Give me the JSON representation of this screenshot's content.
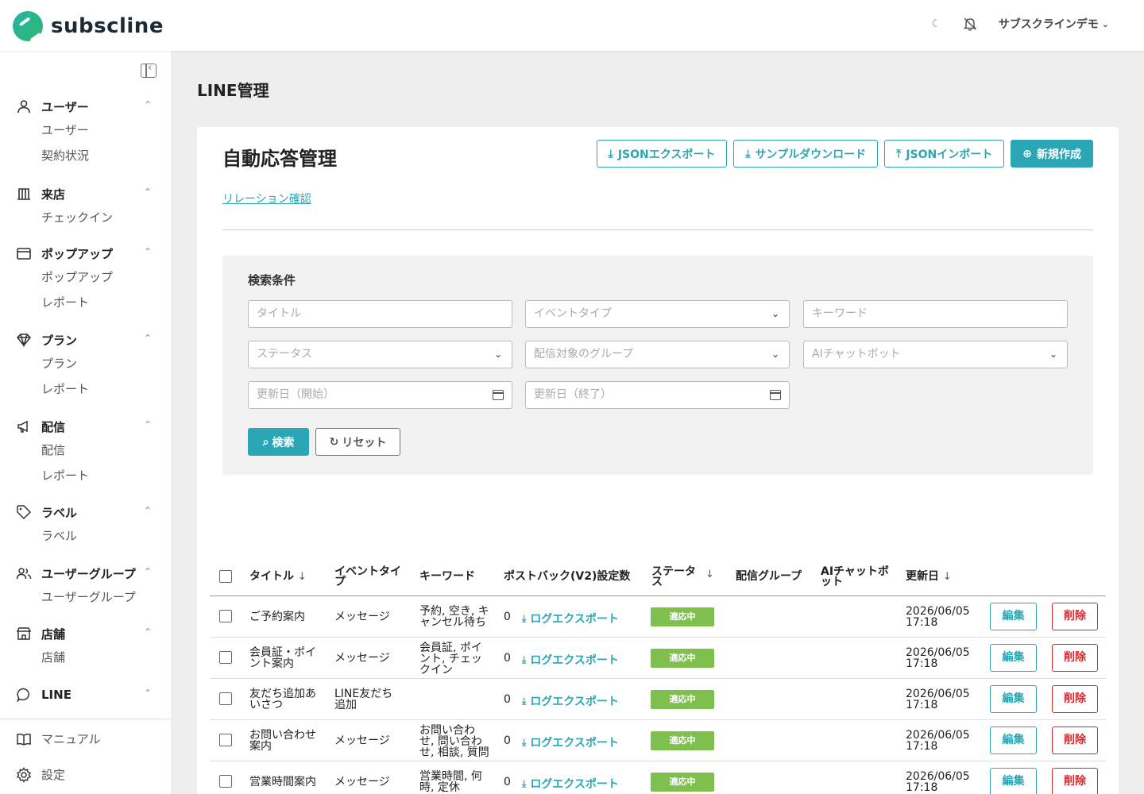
{
  "header": {
    "brand": "subscline",
    "user_menu": "サブスクラインデモ"
  },
  "sidebar": {
    "groups": [
      {
        "label": "ユーザー",
        "items": [
          "ユーザー",
          "契約状況"
        ]
      },
      {
        "label": "来店",
        "items": [
          "チェックイン"
        ]
      },
      {
        "label": "ポップアップ",
        "items": [
          "ポップアップ",
          "レポート"
        ]
      },
      {
        "label": "プラン",
        "items": [
          "プラン",
          "レポート"
        ]
      },
      {
        "label": "配信",
        "items": [
          "配信",
          "レポート"
        ]
      },
      {
        "label": "ラベル",
        "items": [
          "ラベル"
        ]
      },
      {
        "label": "ユーザーグループ",
        "items": [
          "ユーザーグループ"
        ]
      },
      {
        "label": "店舗",
        "items": [
          "店舗"
        ]
      },
      {
        "label": "LINE",
        "items": []
      }
    ],
    "bottom": {
      "manual": "マニュアル",
      "settings": "設定"
    }
  },
  "page": {
    "title": "LINE管理"
  },
  "card": {
    "title": "自動応答管理",
    "buttons": {
      "json_export": "JSONエクスポート",
      "sample_download": "サンプルダウンロード",
      "json_import": "JSONインポート",
      "create": "新規作成"
    },
    "relation_link": "リレーション確認"
  },
  "search": {
    "title": "検索条件",
    "placeholders": {
      "title": "タイトル",
      "event_type": "イベントタイプ",
      "keyword": "キーワード",
      "status": "ステータス",
      "group": "配信対象のグループ",
      "chatbot": "AIチャットボット",
      "date_start": "更新日（開始）",
      "date_end": "更新日（終了）"
    },
    "search_btn": "検索",
    "reset_btn": "リセット"
  },
  "table": {
    "columns": {
      "title": "タイトル",
      "event_type": "イベントタイ\nプ",
      "keyword": "キーワード",
      "postback": "ポストバック(V2)設定数",
      "status": "ステータ\nス",
      "group": "配信グループ",
      "chatbot": "AIチャットボ\nット",
      "updated": "更新日"
    },
    "log_export_label": "ログエクスポート",
    "edit_label": "編集",
    "delete_label": "削除",
    "rows": [
      {
        "title": "ご予約案内",
        "event_type": "メッセージ",
        "keyword": "予約, 空き, キ\nャンセル待ち",
        "postback": "0",
        "status": "適応中",
        "updated": "2026/06/05\n17:18"
      },
      {
        "title": "会員証・ポイ\nント案内",
        "event_type": "メッセージ",
        "keyword": "会員証, ポイ\nント, チェッ\nクイン",
        "postback": "0",
        "status": "適応中",
        "updated": "2026/06/05\n17:18"
      },
      {
        "title": "友だち追加あ\nいさつ",
        "event_type": "LINE友だち\n追加",
        "keyword": "",
        "postback": "0",
        "status": "適応中",
        "updated": "2026/06/05\n17:18"
      },
      {
        "title": "お問い合わせ\n案内",
        "event_type": "メッセージ",
        "keyword": "お問い合わ\nせ, 問い合わ\nせ, 相談, 質問",
        "postback": "0",
        "status": "適応中",
        "updated": "2026/06/05\n17:18"
      },
      {
        "title": "営業時間案内",
        "event_type": "メッセージ",
        "keyword": "営業時間, 何\n時, 定休",
        "postback": "0",
        "status": "適応中",
        "updated": "2026/06/05\n17:18"
      }
    ]
  }
}
